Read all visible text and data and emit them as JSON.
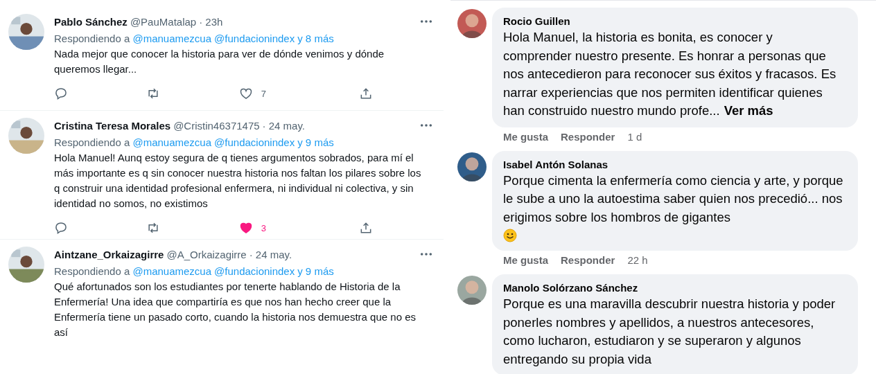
{
  "tweets": [
    {
      "name": "Pablo Sánchez",
      "handle": "@PauMatalap",
      "time": "· 23h",
      "reply_prefix": "Respondiendo a",
      "mentions": [
        "@manuamezcua",
        "@fundacionindex"
      ],
      "reply_more": "y 8 más",
      "text": "Nada mejor que conocer la historia para ver de dónde venimos y dónde queremos llegar...",
      "likes": "7",
      "liked": false
    },
    {
      "name": "Cristina Teresa Morales",
      "handle": "@Cristin46371475",
      "time": "· 24 may.",
      "reply_prefix": "Respondiendo a",
      "mentions": [
        "@manuamezcua",
        "@fundacionindex"
      ],
      "reply_more": "y 9 más",
      "text": "Hola Manuel! Aunq estoy segura de q tienes argumentos sobrados, para mí el más importante es q sin conocer nuestra historia nos faltan los pilares sobre los q construir una identidad profesional enfermera, ni individual ni colectiva, y sin identidad no somos, no existimos",
      "likes": "3",
      "liked": true
    },
    {
      "name": "Aintzane_Orkaizagirre",
      "handle": "@A_Orkaizagirre",
      "time": "· 24 may.",
      "reply_prefix": "Respondiendo a",
      "mentions": [
        "@manuamezcua",
        "@fundacionindex"
      ],
      "reply_more": "y 9 más",
      "text": "Qué afortunados son los estudiantes por tenerte hablando de Historia de la Enfermería! Una idea que compartiría es que nos han hecho creer que la Enfermería tiene un pasado corto, cuando la historia nos demuestra que no es así"
    }
  ],
  "comments": [
    {
      "name": "Rocio Guillen",
      "text": "Hola Manuel, la historia es bonita, es conocer y comprender nuestro presente. Es honrar a personas que nos antecedieron para reconocer sus éxitos y fracasos. Es narrar experiencias que nos permiten identificar quienes han construido nuestro mundo profe...",
      "see_more": "Ver más",
      "actions": [
        "Me gusta",
        "Responder"
      ],
      "time": "1 d",
      "emoji": false
    },
    {
      "name": "Isabel Antón Solanas",
      "text": "Porque cimenta la enfermería como ciencia y arte, y porque le sube a uno la autoestima saber quien nos precedió... nos erigimos sobre los hombros de gigantes",
      "actions": [
        "Me gusta",
        "Responder"
      ],
      "time": "22 h",
      "emoji": true
    },
    {
      "name": "Manolo Solórzano Sánchez",
      "text": "Porque es una maravilla descubrir nuestra historia y poder ponerles nombres y apellidos, a nuestros antecesores, como lucharon, estudiaron y se superaron y algunos entregando su propia vida",
      "emoji": false
    }
  ]
}
